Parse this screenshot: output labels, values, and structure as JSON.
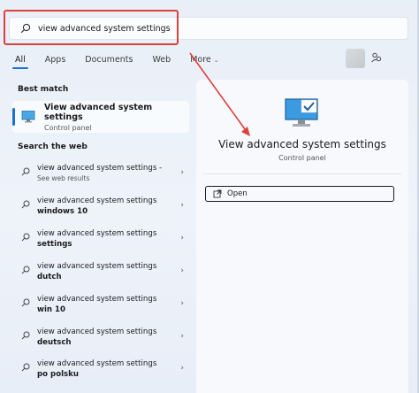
{
  "search": {
    "query": "view advanced system settings"
  },
  "tabs": [
    {
      "label": "All"
    },
    {
      "label": "Apps"
    },
    {
      "label": "Documents"
    },
    {
      "label": "Web"
    },
    {
      "label": "More"
    }
  ],
  "best_match": {
    "section_label": "Best match",
    "title": "View advanced system settings",
    "subtitle": "Control panel"
  },
  "web": {
    "section_label": "Search the web",
    "items": [
      {
        "text": "view advanced system settings -",
        "bold": "",
        "sub": "See web results"
      },
      {
        "text": "view advanced system settings",
        "bold": "windows 10",
        "sub": ""
      },
      {
        "text": "view advanced system settings",
        "bold": "settings",
        "sub": ""
      },
      {
        "text": "view advanced system settings",
        "bold": "dutch",
        "sub": ""
      },
      {
        "text": "view advanced system settings",
        "bold": "win 10",
        "sub": ""
      },
      {
        "text": "view advanced system settings",
        "bold": "deutsch",
        "sub": ""
      },
      {
        "text": "view advanced system settings",
        "bold": "po polsku",
        "sub": ""
      }
    ]
  },
  "preview": {
    "title": "View advanced system settings",
    "subtitle": "Control panel",
    "open_label": "Open"
  },
  "colors": {
    "accent": "#1a6fd6",
    "annotation": "#e0403d"
  }
}
